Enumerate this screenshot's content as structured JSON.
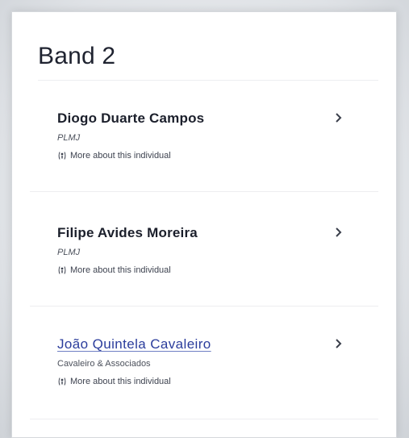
{
  "panel": {
    "title": "Band 2"
  },
  "individuals": [
    {
      "name": "Diogo Duarte Campos",
      "firm": "PLMJ",
      "more_label": "More about this individual",
      "linked": false
    },
    {
      "name": "Filipe Avides Moreira",
      "firm": "PLMJ",
      "more_label": "More about this individual",
      "linked": false
    },
    {
      "name": "João Quintela Cavaleiro",
      "firm": "Cavaleiro & Associados",
      "more_label": "More about this individual",
      "linked": true
    }
  ],
  "icons": {
    "chevron": "chevron-right-icon",
    "info": "person-info-icon"
  },
  "colors": {
    "link": "#2b3d9c",
    "text": "#1b1f2b",
    "muted": "#4c515c"
  }
}
